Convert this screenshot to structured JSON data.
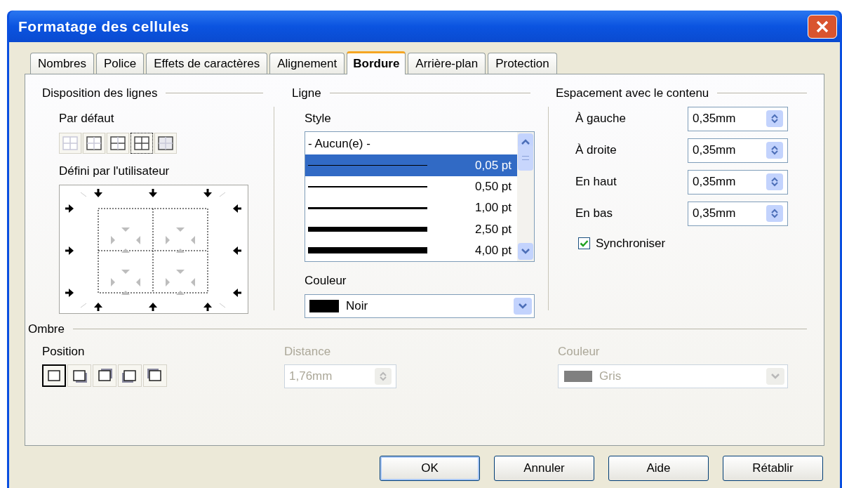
{
  "window": {
    "title": "Formatage des cellules"
  },
  "tabs": [
    {
      "label": "Nombres",
      "selected": false
    },
    {
      "label": "Police",
      "selected": false
    },
    {
      "label": "Effets de caractères",
      "selected": false
    },
    {
      "label": "Alignement",
      "selected": false
    },
    {
      "label": "Bordure",
      "selected": true
    },
    {
      "label": "Arrière-plan",
      "selected": false
    },
    {
      "label": "Protection",
      "selected": false
    }
  ],
  "line_arrangement": {
    "title": "Disposition des lignes",
    "default_label": "Par défaut",
    "presets": [
      {
        "kind": "none",
        "selected": false
      },
      {
        "kind": "outer",
        "selected": false
      },
      {
        "kind": "outer_horizontal",
        "selected": false
      },
      {
        "kind": "outer_all",
        "selected": true
      },
      {
        "kind": "outer_inner_none",
        "selected": false
      }
    ],
    "user_label": "Défini par l'utilisateur"
  },
  "line": {
    "title": "Ligne",
    "style_label": "Style",
    "styles": [
      {
        "label": "- Aucun(e) -",
        "kind": "none",
        "selected": false
      },
      {
        "label": "0,05 pt",
        "kind": "line",
        "selected": true
      },
      {
        "label": "0,50 pt",
        "kind": "line",
        "selected": false
      },
      {
        "label": "1,00 pt",
        "kind": "line",
        "selected": false
      },
      {
        "label": "2,50 pt",
        "kind": "line",
        "selected": false
      },
      {
        "label": "4,00 pt",
        "kind": "line",
        "selected": false
      }
    ],
    "color_label": "Couleur",
    "color": {
      "value": "Noir",
      "color": "#000000"
    }
  },
  "spacing": {
    "title": "Espacement avec le contenu",
    "fields": [
      {
        "label": "À gauche",
        "value": "0,35mm"
      },
      {
        "label": "À droite",
        "value": "0,35mm"
      },
      {
        "label": "En haut",
        "value": "0,35mm"
      },
      {
        "label": "En bas",
        "value": "0,35mm"
      }
    ],
    "synchronize": {
      "label": "Synchroniser",
      "checked": true
    }
  },
  "shadow": {
    "title": "Ombre",
    "position_label": "Position",
    "positions": [
      {
        "kind": "none",
        "selected": true
      },
      {
        "kind": "bottom_right",
        "selected": false
      },
      {
        "kind": "top_right",
        "selected": false
      },
      {
        "kind": "bottom_left",
        "selected": false
      },
      {
        "kind": "top_left",
        "selected": false
      }
    ],
    "distance": {
      "label": "Distance",
      "value": "1,76mm",
      "disabled": true
    },
    "color": {
      "label": "Couleur",
      "value": "Gris",
      "color": "#808080",
      "disabled": true
    }
  },
  "buttons": [
    {
      "label": "OK",
      "default": true
    },
    {
      "label": "Annuler",
      "default": false
    },
    {
      "label": "Aide",
      "default": false
    },
    {
      "label": "Rétablir",
      "default": false
    }
  ]
}
